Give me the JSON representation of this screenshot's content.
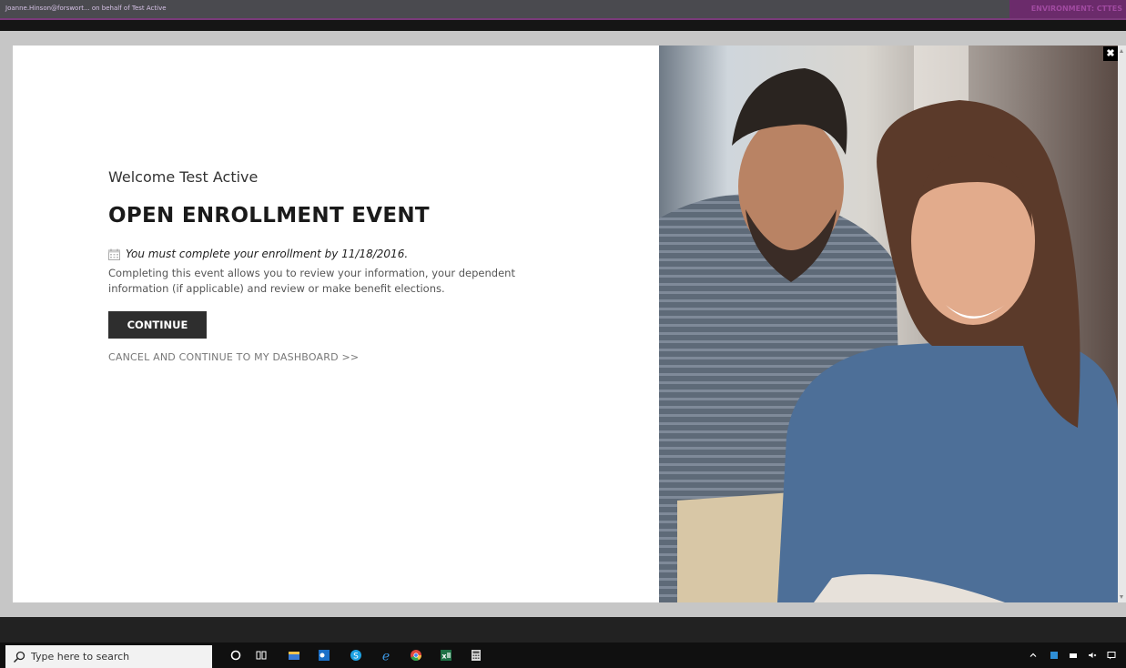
{
  "top_bar": {
    "account_text": "Joanne.Hinson@forswort... on behalf of Test Active",
    "environment_label": "ENVIRONMENT: CTTES"
  },
  "modal": {
    "welcome": "Welcome Test Active",
    "title": "OPEN ENROLLMENT EVENT",
    "deadline": "You must complete your enrollment by 11/18/2016.",
    "description": "Completing this event allows you to review your information, your dependent information (if applicable) and review or make benefit elections.",
    "continue_label": "CONTINUE",
    "cancel_label": "CANCEL AND CONTINUE TO MY DASHBOARD >>",
    "close_glyph": "✖"
  },
  "taskbar": {
    "search_placeholder": "Type here to search",
    "pinned_apps": [
      "cortana-icon",
      "task-view-icon",
      "file-explorer-icon",
      "outlook-icon",
      "skype-icon",
      "edge-icon",
      "chrome-icon",
      "excel-icon",
      "calculator-icon"
    ],
    "tray_icons": [
      "chevron-up-icon",
      "defender-icon",
      "network-icon",
      "volume-icon",
      "notifications-icon"
    ]
  },
  "colors": {
    "button_bg": "#2e2e2e",
    "env_bar": "#6b2b6b",
    "top_line": "#7a3a7a"
  }
}
